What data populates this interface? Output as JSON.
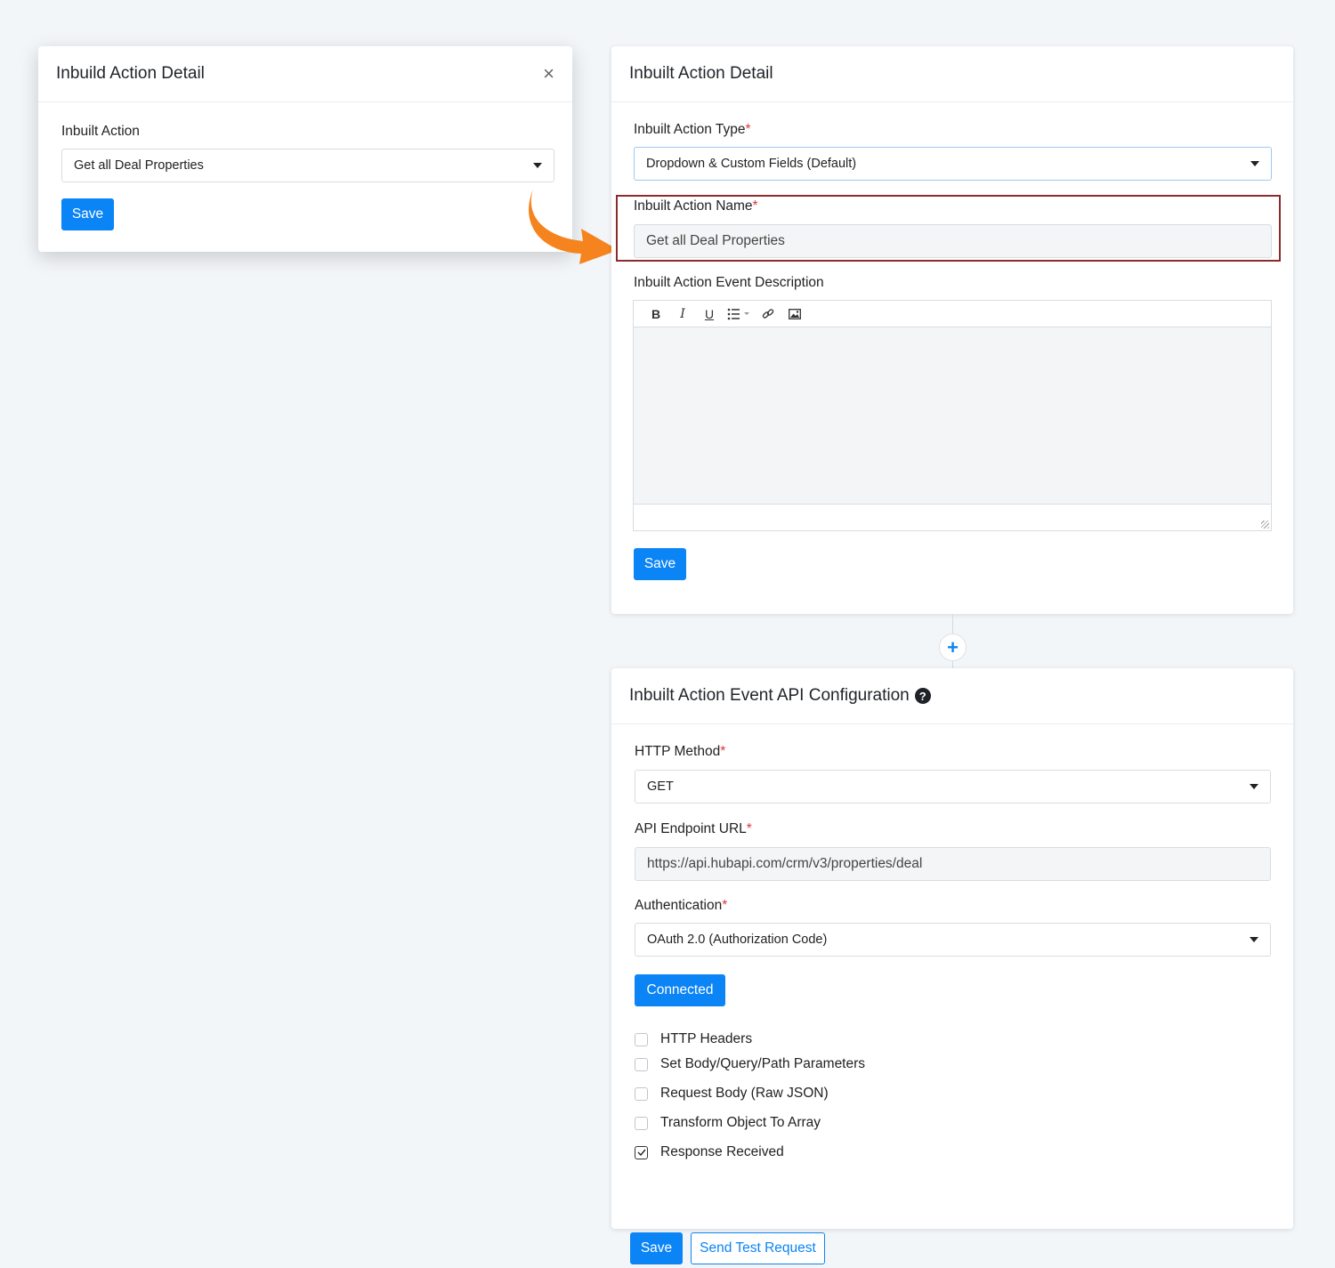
{
  "modal": {
    "title": "Inbuild Action Detail",
    "close_label": "×",
    "field_label": "Inbuilt Action",
    "select_value": "Get all Deal Properties",
    "save_label": "Save"
  },
  "detail": {
    "title": "Inbuilt Action Detail",
    "type_label": "Inbuilt Action Type",
    "type_value": "Dropdown & Custom Fields (Default)",
    "name_label": "Inbuilt Action Name",
    "name_value": "Get all Deal Properties",
    "desc_label": "Inbuilt Action Event Description",
    "toolbar": [
      "B",
      "I",
      "U"
    ],
    "save_label": "Save",
    "required_mark": "*"
  },
  "connector": {
    "plus_label": "+"
  },
  "api": {
    "title": "Inbuilt Action Event API Configuration",
    "help_label": "?",
    "method_label": "HTTP Method",
    "method_value": "GET",
    "endpoint_label": "API Endpoint URL",
    "endpoint_value": "https://api.hubapi.com/crm/v3/properties/deal",
    "auth_label": "Authentication",
    "auth_value": "OAuth 2.0 (Authorization Code)",
    "connected_label": "Connected",
    "checkboxes": [
      {
        "label": "HTTP Headers",
        "checked": false
      },
      {
        "label": "Set Body/Query/Path Parameters",
        "checked": false
      },
      {
        "label": "Request Body (Raw JSON)",
        "checked": false
      },
      {
        "label": "Transform Object To Array",
        "checked": false
      },
      {
        "label": "Response Received",
        "checked": true
      }
    ],
    "save_label": "Save",
    "test_label": "Send Test Request"
  },
  "colors": {
    "primary": "#0b84f5",
    "highlight_border": "#8c2b2b",
    "arrow": "#f5841f",
    "required": "#d93a3a"
  }
}
